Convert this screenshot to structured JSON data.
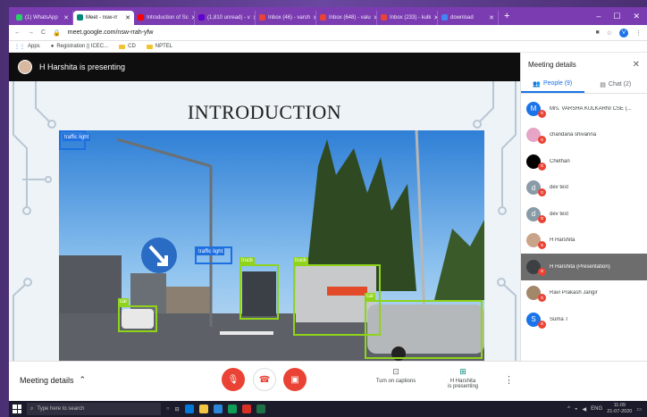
{
  "browser": {
    "tabs": [
      {
        "label": "(1) WhatsApp",
        "color": "#25d366",
        "active": false
      },
      {
        "label": "Meet - nsw-rr",
        "color": "#00897b",
        "active": true
      },
      {
        "label": "Introduction of Sc",
        "color": "#ff0000",
        "active": false
      },
      {
        "label": "(1,810 unread) - v",
        "color": "#6001d2",
        "active": false
      },
      {
        "label": "Inbox (46) - varsh",
        "color": "#ea4335",
        "active": false
      },
      {
        "label": "Inbox (648) - valu",
        "color": "#ea4335",
        "active": false
      },
      {
        "label": "Inbox (233) - kulk",
        "color": "#ea4335",
        "active": false
      },
      {
        "label": "download",
        "color": "#4285f4",
        "active": false
      }
    ],
    "url": "meet.google.com/nsw-rrah-yfw",
    "profile_initial": "V",
    "bookmarks": [
      "Apps",
      "Registration || ICEC...",
      "CD",
      "NPTEL"
    ]
  },
  "meet": {
    "presenter_text": "H Harshita is presenting",
    "slide": {
      "title": "INTRODUCTION",
      "detections": [
        {
          "label": "traffic light",
          "kind": "blue"
        },
        {
          "label": "traffic light",
          "kind": "blue"
        },
        {
          "label": "truck",
          "kind": "green"
        },
        {
          "label": "truck",
          "kind": "green"
        },
        {
          "label": "car",
          "kind": "green"
        },
        {
          "label": "car",
          "kind": "green"
        }
      ]
    },
    "bottom": {
      "meeting_details_label": "Meeting details",
      "captions_label": "Turn on captions",
      "presenting_label_line1": "H Harshita",
      "presenting_label_line2": "is presenting"
    }
  },
  "panel": {
    "title": "Meeting details",
    "people_tab": "People (9)",
    "chat_tab": "Chat (2)",
    "participants": [
      {
        "name": "Mrs. VARSHA KULKARNI CSE (...",
        "initial": "M",
        "color": "#1a73e8",
        "highlight": false
      },
      {
        "name": "chandana shivanna",
        "initial": "",
        "color": "#e6a5c6",
        "highlight": false
      },
      {
        "name": "Chethan",
        "initial": "",
        "color": "#000000",
        "highlight": false
      },
      {
        "name": "dev test",
        "initial": "d",
        "color": "#8a9ba8",
        "highlight": false
      },
      {
        "name": "dev test",
        "initial": "d",
        "color": "#8a9ba8",
        "highlight": false
      },
      {
        "name": "H Harshita",
        "initial": "",
        "color": "#c9a38a",
        "highlight": false
      },
      {
        "name": "H Harshita (Presentation)",
        "initial": "",
        "color": "#3c4043",
        "highlight": true
      },
      {
        "name": "Ravi Prakash Jangir",
        "initial": "",
        "color": "#a3876b",
        "highlight": false
      },
      {
        "name": "Suma T",
        "initial": "S",
        "color": "#1a73e8",
        "highlight": false
      }
    ]
  },
  "taskbar": {
    "search_placeholder": "Type here to search",
    "language": "ENG",
    "time": "11:09",
    "date": "21-07-2020"
  }
}
